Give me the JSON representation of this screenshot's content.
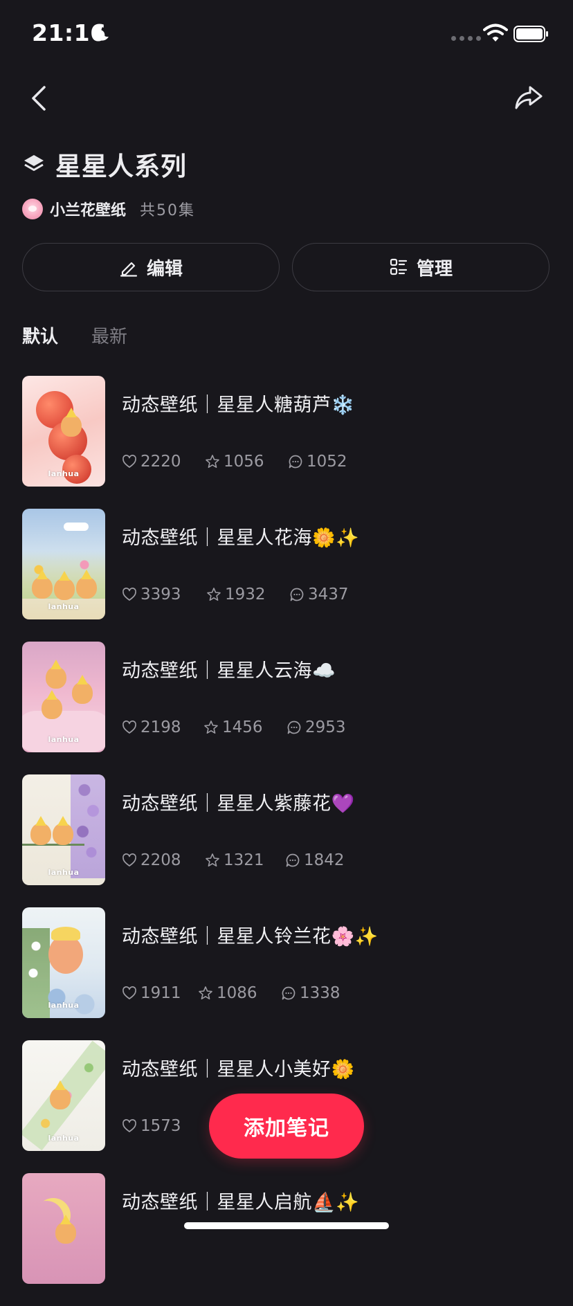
{
  "status_bar": {
    "time": "21:16"
  },
  "collection": {
    "title": "星星人系列",
    "author": "小兰花壁纸",
    "episode_count": "共50集"
  },
  "actions": {
    "edit_label": "编辑",
    "manage_label": "管理"
  },
  "sort_tabs": [
    {
      "label": "默认",
      "active": true
    },
    {
      "label": "最新",
      "active": false
    }
  ],
  "notes": [
    {
      "title": "动态壁纸｜星星人糖葫芦❄️",
      "likes": "2220",
      "collects": "1056",
      "comments": "1052",
      "watermark": "lanhua"
    },
    {
      "title": "动态壁纸｜星星人花海🌼✨",
      "likes": "3393",
      "collects": "1932",
      "comments": "3437",
      "watermark": "lanhua"
    },
    {
      "title": "动态壁纸｜星星人云海☁️",
      "likes": "2198",
      "collects": "1456",
      "comments": "2953",
      "watermark": "lanhua"
    },
    {
      "title": "动态壁纸｜星星人紫藤花💜",
      "likes": "2208",
      "collects": "1321",
      "comments": "1842",
      "watermark": "lanhua"
    },
    {
      "title": "动态壁纸｜星星人铃兰花🌸✨",
      "likes": "1911",
      "collects": "1086",
      "comments": "1338",
      "watermark": "lanhua"
    },
    {
      "title": "动态壁纸｜星星人小美好🌼",
      "likes": "1573",
      "collects": "",
      "comments": "",
      "watermark": "lanhua"
    },
    {
      "title": "动态壁纸｜星星人启航⛵✨",
      "likes": "",
      "collects": "",
      "comments": "",
      "watermark": ""
    }
  ],
  "fab": {
    "label": "添加笔记"
  },
  "colors": {
    "background": "#18171c",
    "accent": "#ff2a4d"
  }
}
